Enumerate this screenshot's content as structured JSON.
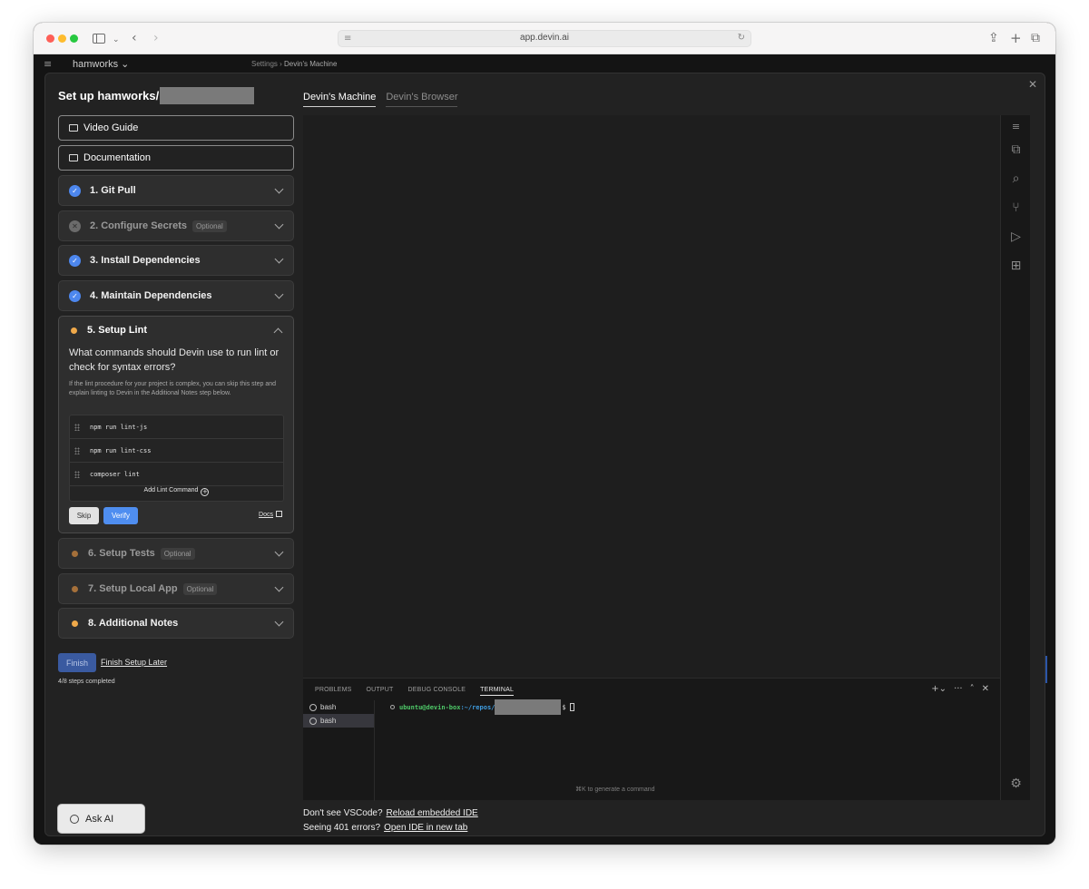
{
  "browser": {
    "url": "app.devin.ai"
  },
  "app": {
    "workspace": "hamworks",
    "breadcrumb": [
      "Settings",
      "Devin's Machine"
    ]
  },
  "setup": {
    "title": "Set up hamworks/",
    "links": {
      "video": "Video Guide",
      "docs": "Documentation"
    },
    "steps": [
      {
        "label": "1. Git Pull",
        "status": "done"
      },
      {
        "label": "2. Configure Secrets",
        "status": "skipped",
        "badge": "Optional"
      },
      {
        "label": "3. Install Dependencies",
        "status": "done"
      },
      {
        "label": "4. Maintain Dependencies",
        "status": "done"
      },
      {
        "label": "5. Setup Lint",
        "status": "active"
      },
      {
        "label": "6. Setup Tests",
        "status": "pending",
        "badge": "Optional"
      },
      {
        "label": "7. Setup Local App",
        "status": "pending",
        "badge": "Optional"
      },
      {
        "label": "8. Additional Notes",
        "status": "todo"
      }
    ],
    "lint": {
      "question": "What commands should Devin use to run lint or check for syntax errors?",
      "help": "If the lint procedure for your project is complex, you can skip this step and explain linting to Devin in the Additional Notes step below.",
      "commands": [
        "npm run lint-js",
        "npm run lint-css",
        "composer lint"
      ],
      "add_label": "Add Lint Command",
      "skip": "Skip",
      "verify": "Verify",
      "docs": "Docs"
    },
    "finish": "Finish",
    "finish_later": "Finish Setup Later",
    "progress": "4/8 steps completed"
  },
  "ask_ai": "Ask AI",
  "tabs": [
    "Devin's Machine",
    "Devin's Browser"
  ],
  "panel": {
    "tabs": [
      "PROBLEMS",
      "OUTPUT",
      "DEBUG CONSOLE",
      "TERMINAL"
    ],
    "terminals": [
      "bash",
      "bash"
    ],
    "prompt_user": "ubuntu@devin-box",
    "prompt_path": ":~/repos/",
    "prompt_symbol": "$",
    "hint": "⌘K to generate a command"
  },
  "footer": {
    "vscode_q": "Don't see VSCode?",
    "vscode_link": "Reload embedded IDE",
    "err_q": "Seeing 401 errors?",
    "err_link": "Open IDE in new tab"
  },
  "colors": {
    "done": "#4d87ee",
    "active_dot": "#f0a94a",
    "pending_dot": "#a5703a",
    "verify": "#4f8ef0",
    "finish": "#3a5aa0"
  }
}
